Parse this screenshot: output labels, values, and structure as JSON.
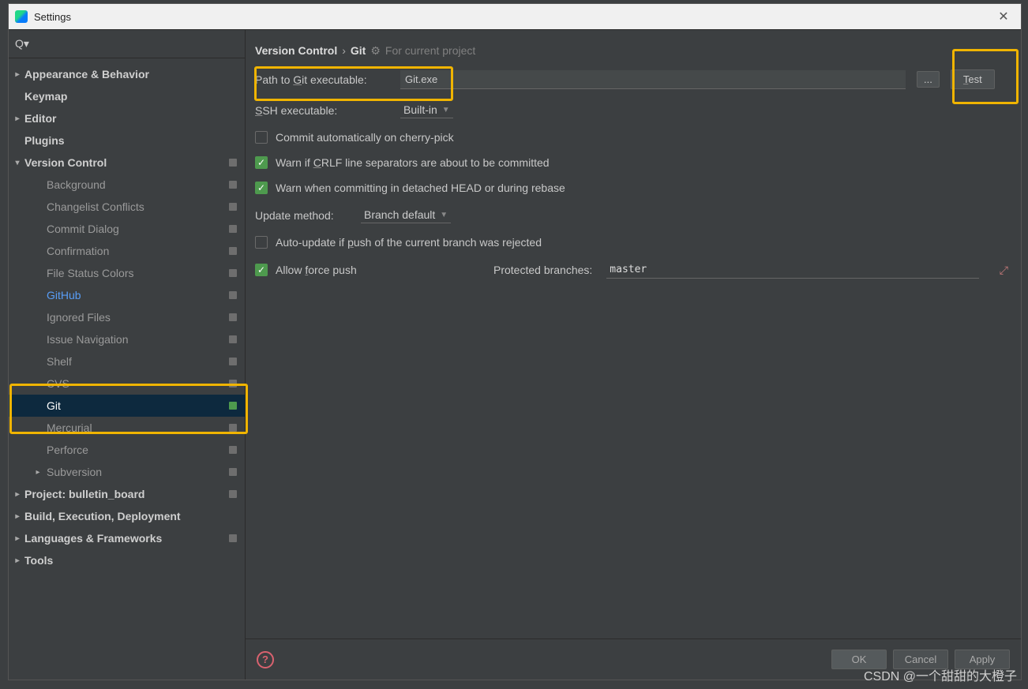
{
  "title": "Settings",
  "breadcrumb": {
    "root": "Version Control",
    "leaf": "Git",
    "note": "For current project"
  },
  "sidebar": {
    "items": [
      {
        "label": "Appearance & Behavior",
        "bold": true,
        "arrow": ">"
      },
      {
        "label": "Keymap",
        "bold": true
      },
      {
        "label": "Editor",
        "bold": true,
        "arrow": ">"
      },
      {
        "label": "Plugins",
        "bold": true
      },
      {
        "label": "Version Control",
        "bold": true,
        "arrow": "v",
        "badge": true
      },
      {
        "label": "Background",
        "child": true,
        "badge": true
      },
      {
        "label": "Changelist Conflicts",
        "child": true,
        "badge": true
      },
      {
        "label": "Commit Dialog",
        "child": true,
        "badge": true
      },
      {
        "label": "Confirmation",
        "child": true,
        "badge": true
      },
      {
        "label": "File Status Colors",
        "child": true,
        "badge": true
      },
      {
        "label": "GitHub",
        "child": true,
        "badge": true,
        "link": true
      },
      {
        "label": "Ignored Files",
        "child": true,
        "badge": true
      },
      {
        "label": "Issue Navigation",
        "child": true,
        "badge": true
      },
      {
        "label": "Shelf",
        "child": true,
        "badge": true
      },
      {
        "label": "CVS",
        "child": true,
        "badge": true
      },
      {
        "label": "Git",
        "child": true,
        "badge": true,
        "git": true,
        "selected": true
      },
      {
        "label": "Mercurial",
        "child": true,
        "badge": true
      },
      {
        "label": "Perforce",
        "child": true,
        "badge": true
      },
      {
        "label": "Subversion",
        "child": true,
        "badge": true,
        "arrow": ">"
      },
      {
        "label": "Project: bulletin_board",
        "bold": true,
        "arrow": ">",
        "badge": true
      },
      {
        "label": "Build, Execution, Deployment",
        "bold": true,
        "arrow": ">"
      },
      {
        "label": "Languages & Frameworks",
        "bold": true,
        "arrow": ">",
        "badge": true
      },
      {
        "label": "Tools",
        "bold": true,
        "arrow": ">"
      }
    ]
  },
  "form": {
    "path_label": "Path to Git executable:",
    "path_value": "Git.exe",
    "browse": "...",
    "test": "Test",
    "ssh_label": "SSH executable:",
    "ssh_value": "Built-in",
    "cherry_pick": "Commit automatically on cherry-pick",
    "crlf": "Warn if CRLF line separators are about to be committed",
    "detached": "Warn when committing in detached HEAD or during rebase",
    "update_label": "Update method:",
    "update_value": "Branch default",
    "auto_update": "Auto-update if push of the current branch was rejected",
    "force_push": "Allow force push",
    "protected_label": "Protected branches:",
    "protected_value": "master"
  },
  "buttons": {
    "ok": "OK",
    "cancel": "Cancel",
    "apply": "Apply"
  },
  "watermark": "CSDN @一个甜甜的大橙子"
}
